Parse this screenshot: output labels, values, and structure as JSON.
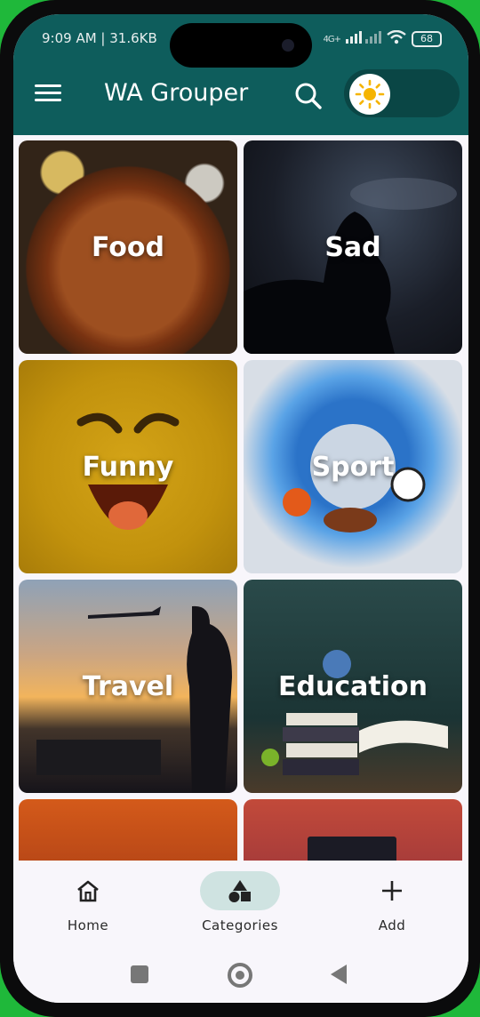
{
  "status_bar": {
    "time": "9:09 AM | 31.6KB",
    "network": "4G+",
    "battery": "68"
  },
  "app_bar": {
    "title": "WA Grouper",
    "menu_icon": "menu-icon",
    "search_icon": "search-icon",
    "theme_toggle_icon": "sun-icon"
  },
  "categories": [
    {
      "label": "Food"
    },
    {
      "label": "Sad"
    },
    {
      "label": "Funny"
    },
    {
      "label": "Sport"
    },
    {
      "label": "Travel"
    },
    {
      "label": "Education"
    }
  ],
  "bottom_nav": {
    "items": [
      {
        "label": "Home",
        "icon": "home-icon"
      },
      {
        "label": "Categories",
        "icon": "shapes-icon",
        "active": true
      },
      {
        "label": "Add",
        "icon": "plus-icon"
      }
    ]
  },
  "colors": {
    "app_bar": "#0e5d5c",
    "active_nav_pill": "#cfe3e1",
    "frame_background": "#1fb83a"
  }
}
